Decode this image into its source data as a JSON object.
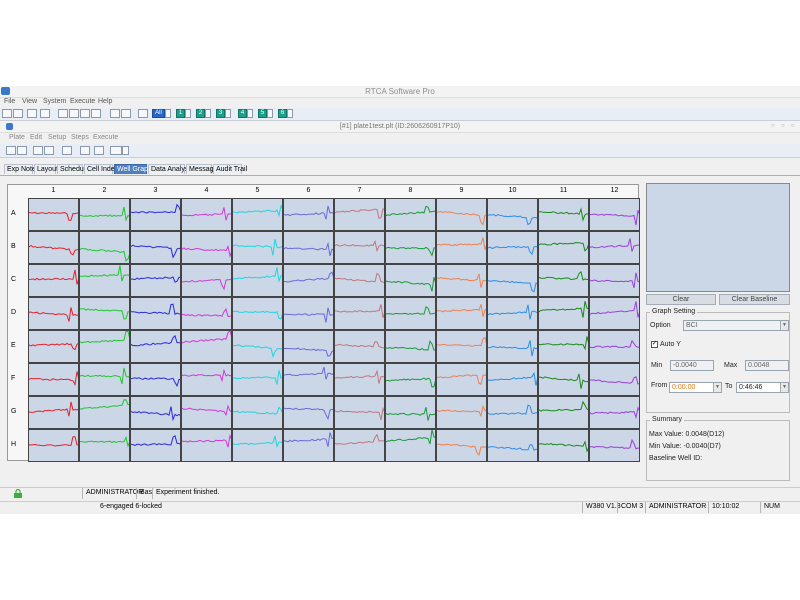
{
  "window": {
    "title": "RTCA Software Pro"
  },
  "menu": [
    "File",
    "View",
    "System",
    "Execute",
    "Help"
  ],
  "toolbar": {
    "buttons": [
      "All",
      "1",
      "2",
      "3",
      "4",
      "5",
      "6"
    ]
  },
  "document": {
    "title": "[#1] plate1test.plt (ID:2606260917P10)"
  },
  "doc_menu": [
    "Plate",
    "Edit",
    "Setup",
    "Steps",
    "Execute"
  ],
  "tabs": [
    "Exp Notes",
    "Layout",
    "Schedule",
    "Cell Index",
    "Well Graph",
    "Data Analysis",
    "Message",
    "Audit Trail"
  ],
  "active_tab": "Well Graph",
  "plate": {
    "columns": [
      "1",
      "2",
      "3",
      "4",
      "5",
      "6",
      "7",
      "8",
      "9",
      "10",
      "11",
      "12"
    ],
    "rows": [
      "A",
      "B",
      "C",
      "D",
      "E",
      "F",
      "G",
      "H"
    ],
    "col_colors": [
      "#e8202a",
      "#1fc62e",
      "#2a2ad8",
      "#d238d8",
      "#1fd6e0",
      "#6a6ad8",
      "#c07880",
      "#1a9a3a",
      "#f08050",
      "#2d8ee8",
      "#1a8a1a",
      "#9a40d8"
    ]
  },
  "panel": {
    "clear": "Clear",
    "clear_baseline": "Clear Baseline",
    "graph_setting": "Graph Setting",
    "option_label": "Option",
    "option_value": "BCI",
    "auto_y": "Auto Y",
    "min_label": "Min",
    "min_value": "-0.0040",
    "max_label": "Max",
    "max_value": "0.0048",
    "from_label": "From",
    "from_value": "0:00:00",
    "to_label": "To",
    "to_value": "0:46:46",
    "summary": "Summary",
    "max_text": "Max Value: 0.0048(D12)",
    "min_text": "Min Value: -0.0040(D7)",
    "baseline_text": "Baseline Well ID:"
  },
  "status": {
    "user": "ADMINISTRATOR",
    "mode": "Bas",
    "message": "Experiment finished."
  },
  "status_bottom": {
    "engaged": "6-engaged  6-locked",
    "version": "W380 V1.3",
    "port": "COM 3",
    "user": "ADMINISTRATOR",
    "time": "10:10:02",
    "num": "NUM"
  }
}
